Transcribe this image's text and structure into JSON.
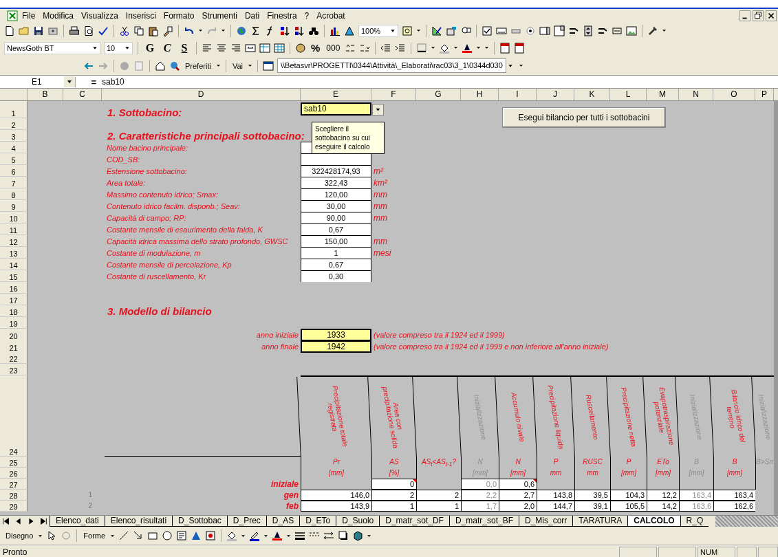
{
  "menu": [
    "File",
    "Modifica",
    "Visualizza",
    "Inserisci",
    "Formato",
    "Strumenti",
    "Dati",
    "Finestra",
    "?",
    "Acrobat"
  ],
  "standard_toolbar": {
    "zoom": "100%"
  },
  "format_toolbar": {
    "font": "NewsGoth BT",
    "size": "10",
    "style_buttons": [
      "G",
      "C",
      "S"
    ],
    "percent": "%",
    "thousands": "000"
  },
  "web_toolbar": {
    "favorites": "Preferiti",
    "go": "Vai",
    "address": "\\\\Betasvr\\PROGETTI\\0344\\Attività\\_Elaborati\\rac03\\3_1\\0344d030"
  },
  "formula_bar": {
    "cell": "E1",
    "equals": "=",
    "value": "sab10"
  },
  "columns": [
    "B",
    "C",
    "D",
    "E",
    "F",
    "G",
    "H",
    "I",
    "J",
    "K",
    "L",
    "M",
    "N",
    "O",
    "P"
  ],
  "row_numbers": [
    "1",
    "2",
    "3",
    "4",
    "5",
    "6",
    "7",
    "8",
    "9",
    "10",
    "11",
    "12",
    "13",
    "14",
    "15",
    "16",
    "17",
    "18",
    "19",
    "20",
    "21",
    "22",
    "23",
    "24",
    "25",
    "26",
    "27",
    "28",
    "29"
  ],
  "section_1": "1. Sottobacino:",
  "subbasin": "sab10",
  "tooltip": "Scegliere il sottobacino su cui eseguire il calcolo",
  "run_button": "Esegui bilancio per tutti i sottobacini",
  "section_2": "2. Caratteristiche principali sottobacino:",
  "parameters": [
    {
      "label": "Nome bacino principale:"
    },
    {
      "label": "COD_SB:"
    },
    {
      "label": "Estensione sottobacino:",
      "value": "322428174,93",
      "unit": "m²"
    },
    {
      "label": "Area totale:",
      "value": "322,43",
      "unit": "km²"
    },
    {
      "label": "Massimo contenuto idrico; Smax:",
      "value": "120,00",
      "unit": "mm"
    },
    {
      "label": "Contenuto idrico facilm. disponb.; Seav:",
      "value": "30,00",
      "unit": "mm"
    },
    {
      "label": "Capacità di campo; RP:",
      "value": "90,00",
      "unit": "mm"
    },
    {
      "label": "Costante mensile di esaurimento della falda, K",
      "value": "0,67"
    },
    {
      "label": "Capacità idrica massima dello strato profondo, GWSC",
      "value": "150,00",
      "unit": "mm"
    },
    {
      "label": "Costante di modulazione, m",
      "value": "1",
      "unit": "mesi"
    },
    {
      "label": "Costante mensile di percolazione, Kp",
      "value": "0,67"
    },
    {
      "label": "Costante di ruscellamento, Kr",
      "value": "0,30"
    }
  ],
  "section_3": "3. Modello di bilancio",
  "years": [
    {
      "label": "anno iniziale",
      "value": "1933",
      "note": "(valore compreso tra il 1924 ed il 1999)"
    },
    {
      "label": "anno finale",
      "value": "1942",
      "note": "(valore compreso tra il 1924 ed il 1999 e non inferiore all'anno iniziale)"
    }
  ],
  "table": {
    "initial_label": "iniziale",
    "headers": [
      {
        "title": "Precipitazione totale registrata",
        "symbol": "Pr",
        "unit": "[mm]",
        "greyed": false
      },
      {
        "title": "Area con precipitazione solida",
        "symbol": "AS",
        "unit": "[%]",
        "greyed": false,
        "initial": "0",
        "comment": true
      },
      {
        "symbol": "AS$_{t}$<AS$_{t-1}$?",
        "greyed": false
      },
      {
        "title": "Inizializzazione",
        "symbol": "N",
        "unit": "[mm]",
        "greyed": true,
        "initial": "0,0"
      },
      {
        "title": "Accumulo nivale",
        "symbol": "N",
        "unit": "[mm]",
        "greyed": false,
        "initial": "0,6",
        "comment": true
      },
      {
        "title": "Precipitazione liquida",
        "symbol": "P",
        "unit": "mm",
        "greyed": false
      },
      {
        "title": "Ruscellamento",
        "symbol": "RUSC",
        "unit": "mm",
        "greyed": false
      },
      {
        "title": "Precipitazione netta",
        "symbol": "P",
        "unit": "[mm]",
        "greyed": false
      },
      {
        "title": "Evapotraspirazione potenziale",
        "symbol": "ETo",
        "unit": "[mm]",
        "greyed": false
      },
      {
        "title": "Inizializzazione",
        "symbol": "B",
        "unit": "[mm]",
        "greyed": true
      },
      {
        "title": "Bilancio idrico del terreno",
        "symbol": "B",
        "unit": "[mm]",
        "greyed": false
      },
      {
        "title": "Inizializzazione",
        "symbol": "B>Sm",
        "greyed": true
      }
    ],
    "rows": [
      {
        "number": "1",
        "month": "gen",
        "values": [
          "146,0",
          "2",
          "2",
          "2,2",
          "2,7",
          "143,8",
          "39,5",
          "104,3",
          "12,2",
          "163,4",
          "163,4"
        ]
      },
      {
        "number": "2",
        "month": "feb",
        "values": [
          "143,9",
          "1",
          "1",
          "1,7",
          "2,0",
          "144,7",
          "39,1",
          "105,5",
          "14,2",
          "163,6",
          "162,6"
        ]
      }
    ]
  },
  "sheet_tabs": [
    {
      "label": "Elenco_dati",
      "selected": false
    },
    {
      "label": "Elenco_risultati",
      "selected": false
    },
    {
      "label": "D_Sottobac",
      "selected": false
    },
    {
      "label": "D_Prec",
      "selected": false
    },
    {
      "label": "D_AS",
      "selected": false
    },
    {
      "label": "D_ETo",
      "selected": false
    },
    {
      "label": "D_Suolo",
      "selected": false
    },
    {
      "label": "D_matr_sot_DF",
      "selected": false
    },
    {
      "label": "D_matr_sot_BF",
      "selected": false
    },
    {
      "label": "D_Mis_corr",
      "selected": false
    },
    {
      "label": "TARATURA",
      "selected": false
    },
    {
      "label": "CALCOLO",
      "selected": true
    },
    {
      "label": "R_Q",
      "selected": false
    }
  ],
  "drawing_toolbar": {
    "draw": "Disegno",
    "shapes": "Forme"
  },
  "status_bar": {
    "text": "Pronto",
    "num": "NUM"
  }
}
